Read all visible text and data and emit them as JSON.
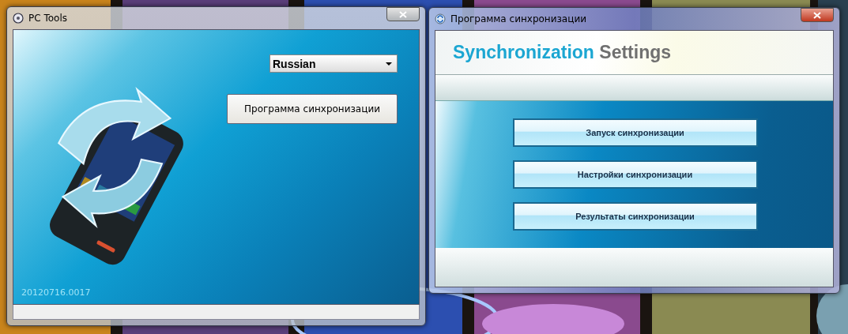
{
  "windows": [
    {
      "kind": "launcher",
      "title": "PC Tools",
      "active": false,
      "language_select": {
        "value": "Russian"
      },
      "button": "Программа синхронизации",
      "version": "20120716.0017"
    },
    {
      "kind": "sync",
      "title": "Программа синхронизации",
      "active": true,
      "heading": {
        "accent": "Synchronization",
        "rest": "Settings"
      },
      "buttons": [
        "Запуск синхронизации",
        "Настройки синхронизации",
        "Результаты синхронизации"
      ]
    }
  ]
}
